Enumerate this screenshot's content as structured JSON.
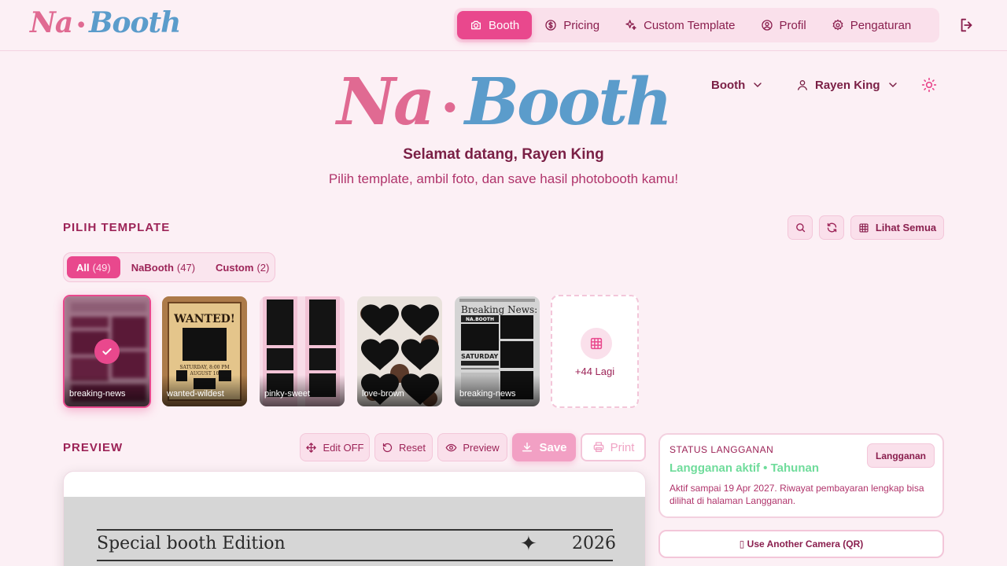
{
  "brand": {
    "na": "Na",
    "dot": "•",
    "booth": "Booth",
    "pink": "#e06a92",
    "blue": "#5b9ccb"
  },
  "nav": {
    "items": [
      {
        "label": "Booth",
        "icon": "camera-icon",
        "active": true
      },
      {
        "label": "Pricing",
        "icon": "dollar-circle-icon"
      },
      {
        "label": "Custom Template",
        "icon": "sparkles-icon"
      },
      {
        "label": "Profil",
        "icon": "user-circle-icon"
      },
      {
        "label": "Pengaturan",
        "icon": "gear-icon"
      }
    ],
    "logout_icon": "logout-icon"
  },
  "hero": {
    "welcome": "Selamat datang, Rayen King",
    "subtitle": "Pilih template, ambil foto, dan save hasil photobooth kamu!",
    "mode_select": "Booth",
    "user_menu": "Rayen King",
    "theme_icon": "sun-icon"
  },
  "templates": {
    "title": "PILIH TEMPLATE",
    "view_all": "Lihat Semua",
    "filters": [
      {
        "label": "All",
        "count": "(49)",
        "active": true
      },
      {
        "label": "NaBooth",
        "count": "(47)"
      },
      {
        "label": "Custom",
        "count": "(2)"
      }
    ],
    "items": [
      {
        "name": "breaking-news",
        "selected": true
      },
      {
        "name": "wanted-wildest"
      },
      {
        "name": "pinky-sweet"
      },
      {
        "name": "love-brown"
      },
      {
        "name": "breaking-news"
      }
    ],
    "more_label": "+44 Lagi",
    "thumb_text": {
      "wanted": "WANTED!",
      "wanted_date": "SATURDAY, 8:00 PM",
      "wanted_date2": "AUGUST 10",
      "news_head": "Breaking News:",
      "news_brand": "NA.BOOTH",
      "news_day": "SATURDAY"
    }
  },
  "preview": {
    "title": "PREVIEW",
    "buttons": {
      "edit": "Edit OFF",
      "reset": "Reset",
      "preview": "Preview",
      "save": "Save",
      "print": "Print"
    },
    "canvas": {
      "heading": "Special booth Edition",
      "star": "✦",
      "year": "2026"
    }
  },
  "subscription": {
    "label": "STATUS LANGGANAN",
    "status": "Langganan aktif • Tahunan",
    "description": "Aktif sampai 19 Apr 2027. Riwayat pembayaran lengkap bisa dilihat di halaman Langganan.",
    "button": "Langganan"
  },
  "camera_qr": "▯ Use Another Camera (QR)",
  "colors": {
    "accent": "#e9488d",
    "background": "#fcf0f5",
    "success": "#6fdc9b"
  }
}
